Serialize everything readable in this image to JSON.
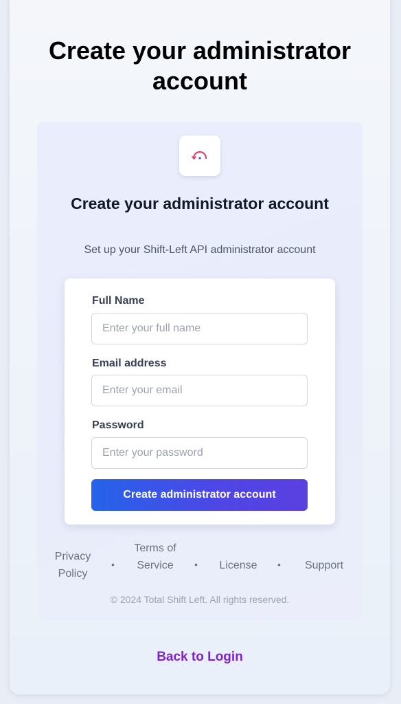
{
  "page": {
    "title": "Create your administrator account"
  },
  "card": {
    "logo_icon": "arc-logo-icon",
    "title": "Create your administrator account",
    "subtitle": "Set up your Shift-Left API administrator account"
  },
  "form": {
    "full_name": {
      "label": "Full Name",
      "placeholder": "Enter your full name",
      "value": ""
    },
    "email": {
      "label": "Email address",
      "placeholder": "Enter your email",
      "value": ""
    },
    "password": {
      "label": "Password",
      "placeholder": "Enter your password",
      "value": ""
    },
    "submit_label": "Create administrator account"
  },
  "footer": {
    "links": {
      "privacy": "Privacy Policy",
      "terms": "Terms of Service",
      "license": "License",
      "support": "Support"
    },
    "separator": "•",
    "copyright": "© 2024 Total Shift Left. All rights reserved."
  },
  "back_link": "Back to Login",
  "colors": {
    "accent_start": "#2563eb",
    "accent_end": "#4f46e5",
    "back_link": "#7e22ce",
    "logo_arc": "#e0466a"
  }
}
